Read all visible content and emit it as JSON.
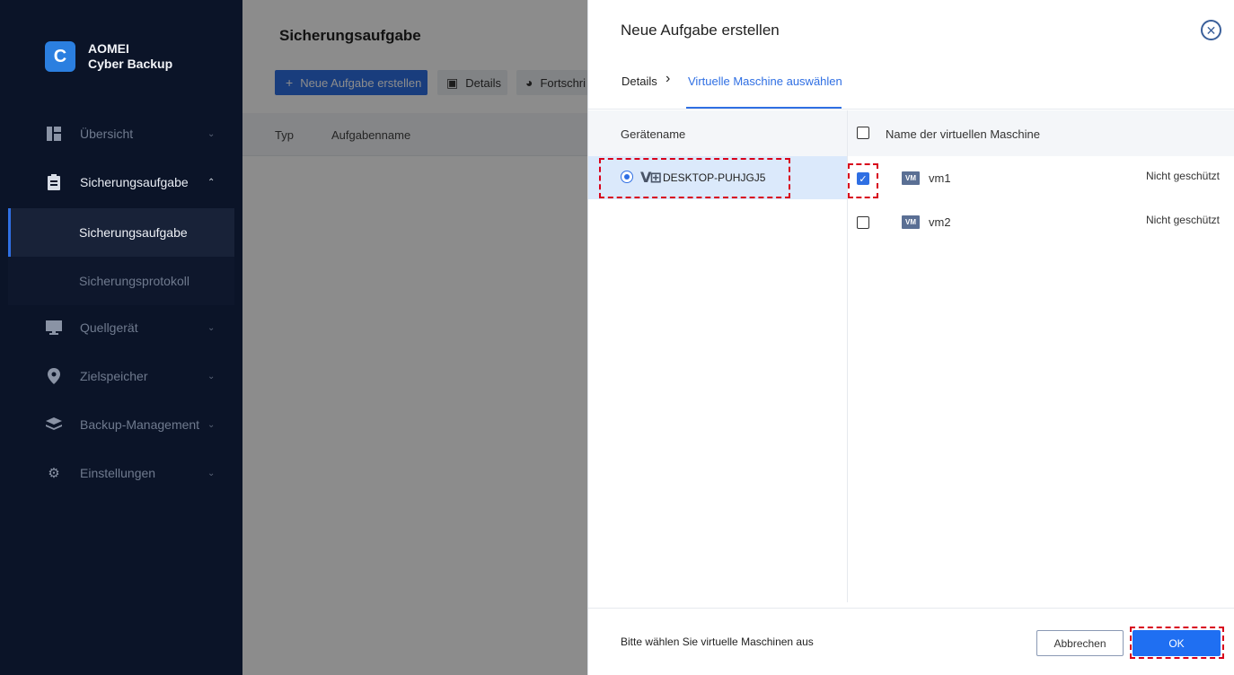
{
  "app": {
    "brand_line1": "AOMEI",
    "brand_line2": "Cyber Backup",
    "logo_glyph": "C"
  },
  "sidebar": {
    "items": [
      {
        "label": "Übersicht",
        "icon": "dashboard-icon",
        "state": "collapsed"
      },
      {
        "label": "Sicherungsaufgabe",
        "icon": "clipboard-icon",
        "state": "expanded"
      },
      {
        "label": "Quellgerät",
        "icon": "monitor-icon",
        "state": "collapsed"
      },
      {
        "label": "Zielspeicher",
        "icon": "location-pin-icon",
        "state": "collapsed"
      },
      {
        "label": "Backup-Management",
        "icon": "layers-icon",
        "state": "collapsed"
      },
      {
        "label": "Einstellungen",
        "icon": "gear-icon",
        "state": "collapsed"
      }
    ],
    "subitems": [
      {
        "label": "Sicherungsaufgabe",
        "active": true
      },
      {
        "label": "Sicherungsprotokoll",
        "active": false
      }
    ]
  },
  "main": {
    "title": "Sicherungsaufgabe",
    "toolbar": {
      "new_task": "Neue Aufgabe erstellen",
      "details": "Details",
      "progress": "Fortschri"
    },
    "columns": [
      "Typ",
      "Aufgabenname"
    ]
  },
  "drawer": {
    "title": "Neue Aufgabe erstellen",
    "steps": [
      "Details",
      "Virtuelle Maschine auswählen"
    ],
    "device_header": "Gerätename",
    "device": "DESKTOP-PUHJGJ5",
    "vm_header": "Name der virtuellen Maschine",
    "vm_badge": "VM",
    "vms": [
      {
        "name": "vm1",
        "status": "Nicht geschützt",
        "checked": true
      },
      {
        "name": "vm2",
        "status": "Nicht geschützt",
        "checked": false
      }
    ],
    "footer_message": "Bitte wählen Sie virtuelle Maschinen aus",
    "cancel": "Abbrechen",
    "ok": "OK"
  },
  "colors": {
    "accent": "#2f6fe3",
    "sidebar_bg": "#0b1428",
    "highlight_dash": "#d8001b",
    "selected_row": "#dbe9fb"
  }
}
